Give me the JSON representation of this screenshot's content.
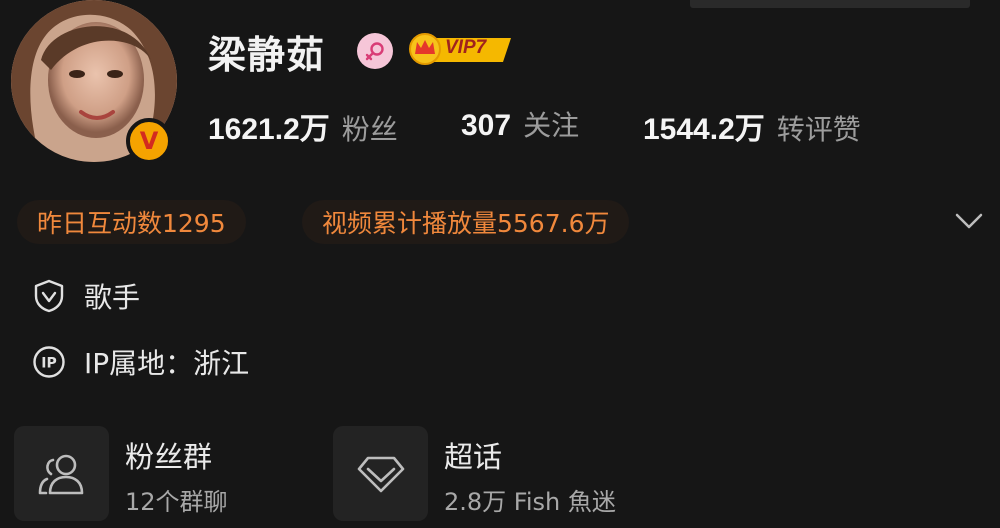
{
  "profile": {
    "name": "梁静茹",
    "vip_label": "VIP7",
    "verified_mark": "V"
  },
  "stats": [
    {
      "value": "1621.2万",
      "label": "粉丝"
    },
    {
      "value": "307",
      "label": "关注"
    },
    {
      "value": "1544.2万",
      "label": "转评赞"
    }
  ],
  "highlights": [
    {
      "text": "昨日互动数1295"
    },
    {
      "text": "视频累计播放量5567.6万"
    }
  ],
  "info": {
    "occupation": "歌手",
    "ip_location": "IP属地：浙江"
  },
  "cards": [
    {
      "title": "粉丝群",
      "subtitle": "12个群聊",
      "icon": "group-icon"
    },
    {
      "title": "超话",
      "subtitle": "2.8万 Fish 魚迷",
      "icon": "diamond-icon"
    }
  ],
  "colors": {
    "background": "#161616",
    "accent_orange": "#f0883c",
    "verified_badge": "#f5a300",
    "vip_gold": "#f5b800",
    "gender_pink": "#f6c6d8"
  }
}
